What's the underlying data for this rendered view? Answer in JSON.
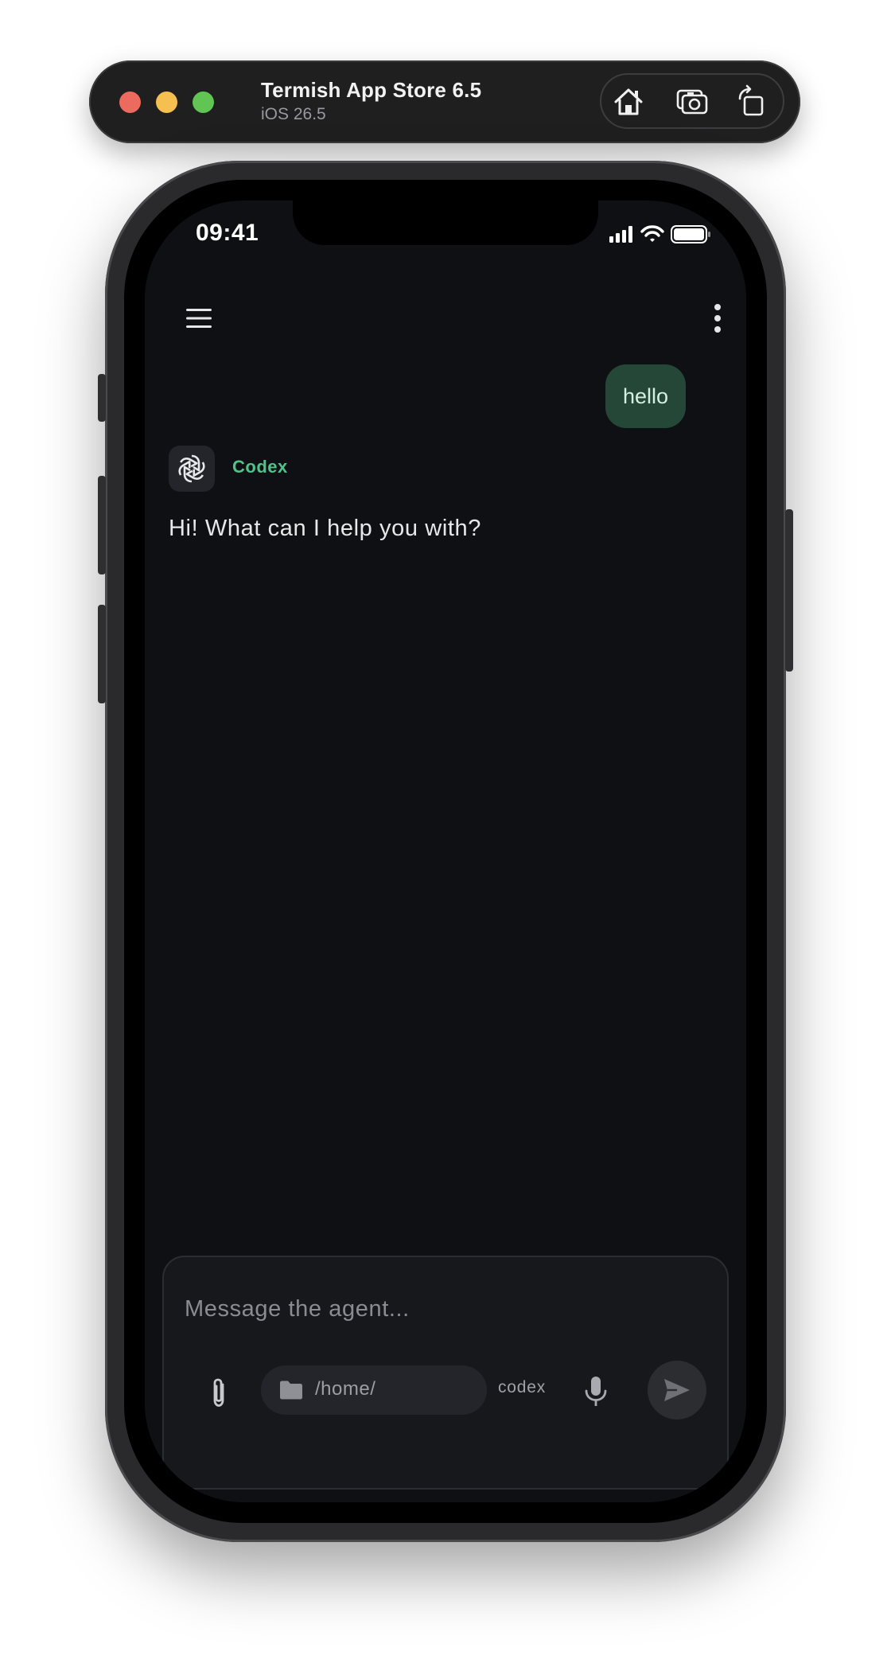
{
  "window": {
    "title": "Termish App Store 6.5",
    "subtitle": "iOS 26.5",
    "buttons": [
      "home-icon",
      "screenshot-icon",
      "rotate-icon"
    ]
  },
  "status_bar": {
    "time": "09:41",
    "icons": [
      "cellular-signal-icon",
      "wifi-icon",
      "battery-icon"
    ]
  },
  "header": {
    "menu_icon": "hamburger-menu-icon",
    "more_icon": "more-vertical-icon"
  },
  "conversation": {
    "user_message": "hello",
    "agent": {
      "name": "Codex",
      "avatar_icon": "openai-logo-icon",
      "message": "Hi! What can I help you with?"
    }
  },
  "composer": {
    "placeholder": "Message the agent...",
    "directory": "/home/",
    "model": "codex",
    "icons": [
      "paperclip-icon",
      "folder-icon",
      "microphone-icon",
      "send-icon"
    ]
  },
  "colors": {
    "background": "#0f1013",
    "accent_green": "#4fc38a",
    "user_bubble": "#244737"
  }
}
